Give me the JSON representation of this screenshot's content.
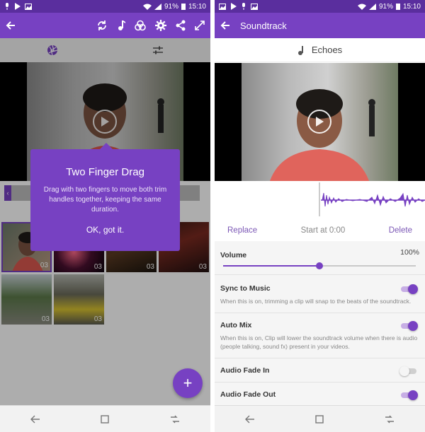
{
  "status_bar": {
    "battery": "91%",
    "time": "15:10"
  },
  "left_screen": {
    "tooltip": {
      "title": "Two Finger Drag",
      "body": "Drag with two fingers to move both trim handles together, keeping the same duration.",
      "button": "OK, got it."
    },
    "clips": [
      {
        "duration": "03"
      },
      {
        "duration": "03"
      },
      {
        "duration": "03"
      },
      {
        "duration": "03"
      },
      {
        "duration": "03"
      },
      {
        "duration": "03"
      }
    ],
    "fab_label": "+"
  },
  "right_screen": {
    "title": "Soundtrack",
    "song_name": "Echoes",
    "actions": {
      "replace": "Replace",
      "start_at": "Start at 0:00",
      "delete": "Delete"
    },
    "volume": {
      "label": "Volume",
      "value_text": "100%",
      "level": 0.5
    },
    "settings": [
      {
        "label": "Sync to Music",
        "description": "When this is on, trimming a clip will snap to the beats of the soundtrack.",
        "on": true
      },
      {
        "label": "Auto Mix",
        "description": "When this is on, Clip will lower the soundtrack volume when there is audio (people talking, sound fx) present in your videos.",
        "on": true
      },
      {
        "label": "Audio Fade In",
        "description": "",
        "on": false
      },
      {
        "label": "Audio Fade Out",
        "description": "",
        "on": true
      }
    ]
  },
  "colors": {
    "accent": "#7741c2",
    "accent_dark": "#5a2e9e"
  },
  "icons": {
    "app_bar": [
      "back-arrow-icon",
      "refresh-icon",
      "music-note-icon",
      "color-filter-icon",
      "gear-icon",
      "share-icon",
      "expand-icon"
    ],
    "nav": [
      "back-icon",
      "home-icon",
      "recents-icon"
    ]
  }
}
